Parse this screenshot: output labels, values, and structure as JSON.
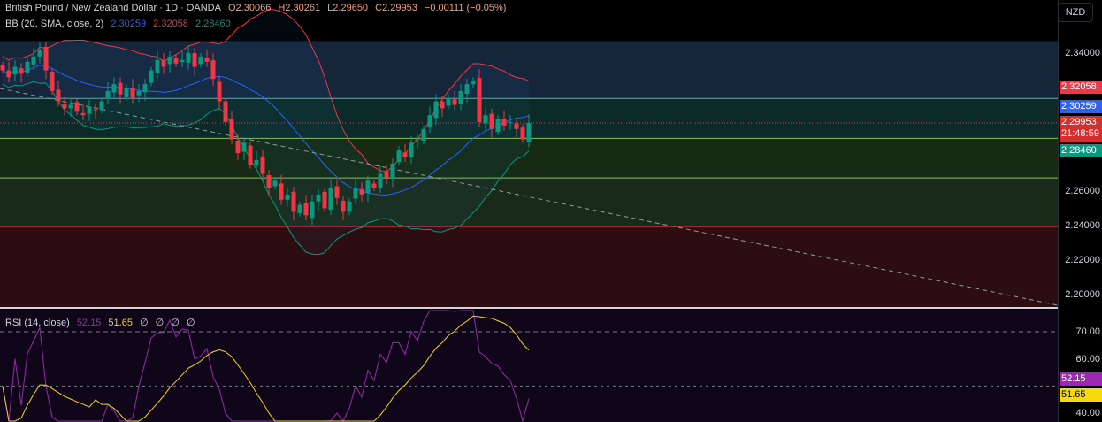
{
  "legend": {
    "symbol": "British Pound / New Zealand Dollar · 1D · OANDA",
    "open": "O2.30066",
    "high": "H2.30261",
    "low": "L2.29650",
    "close": "C2.29953",
    "change": "−0.00111 (−0.05%)",
    "bb_label": "BB (20, SMA, close, 2)",
    "bb_basis": "2.30259",
    "bb_upper": "2.32058",
    "bb_lower": "2.28460"
  },
  "rsi_legend": {
    "label": "RSI (14, close)",
    "rsi": "52.15",
    "ma": "51.65",
    "extras": [
      "∅",
      "∅",
      "∅",
      "∅"
    ]
  },
  "axis": {
    "currency": "NZD",
    "price_ticks": [
      "2.34000",
      "2.26000",
      "2.24000",
      "2.22000",
      "2.20000"
    ],
    "rsi_ticks": [
      "70.00",
      "60.00",
      "40.00"
    ],
    "tags": {
      "upper": "2.32058",
      "basis": "2.30259",
      "price": "2.29953",
      "countdown": "21:48:59",
      "lower": "2.28460",
      "rsi": "52.15",
      "rsi_ma": "51.65"
    }
  },
  "colors": {
    "up": "#089981",
    "down": "#f23645",
    "basis": "#2962ff",
    "upper": "#f23645",
    "lower": "#089981",
    "rsi": "#9c27b0",
    "rsi_ma": "#f5d90a"
  },
  "chart_data": {
    "type": "candlestick",
    "title": "British Pound / New Zealand Dollar · 1D · OANDA",
    "ylim": [
      2.195,
      2.352
    ],
    "horizontal_levels": [
      2.3465,
      2.3137,
      2.2906,
      2.2676,
      2.2394
    ],
    "closes": [
      2.33,
      2.326,
      2.332,
      2.328,
      2.335,
      2.338,
      2.342,
      2.33,
      2.318,
      2.312,
      2.308,
      2.31,
      2.306,
      2.304,
      2.309,
      2.307,
      2.312,
      2.318,
      2.322,
      2.316,
      2.32,
      2.314,
      2.318,
      2.322,
      2.33,
      2.336,
      2.332,
      2.338,
      2.334,
      2.336,
      2.34,
      2.332,
      2.338,
      2.335,
      2.325,
      2.312,
      2.3,
      2.29,
      2.282,
      2.288,
      2.275,
      2.278,
      2.27,
      2.262,
      2.266,
      2.255,
      2.258,
      2.248,
      2.252,
      2.246,
      2.254,
      2.258,
      2.25,
      2.262,
      2.256,
      2.248,
      2.254,
      2.262,
      2.258,
      2.266,
      2.262,
      2.27,
      2.268,
      2.276,
      2.284,
      2.28,
      2.288,
      2.29,
      2.296,
      2.304,
      2.312,
      2.308,
      2.314,
      2.31,
      2.318,
      2.322,
      2.324,
      2.3,
      2.304,
      2.296,
      2.302,
      2.298,
      2.3,
      2.296,
      2.29,
      2.2995
    ],
    "rsi_ylim": [
      36,
      76
    ],
    "rsi_levels": [
      70,
      50
    ]
  }
}
